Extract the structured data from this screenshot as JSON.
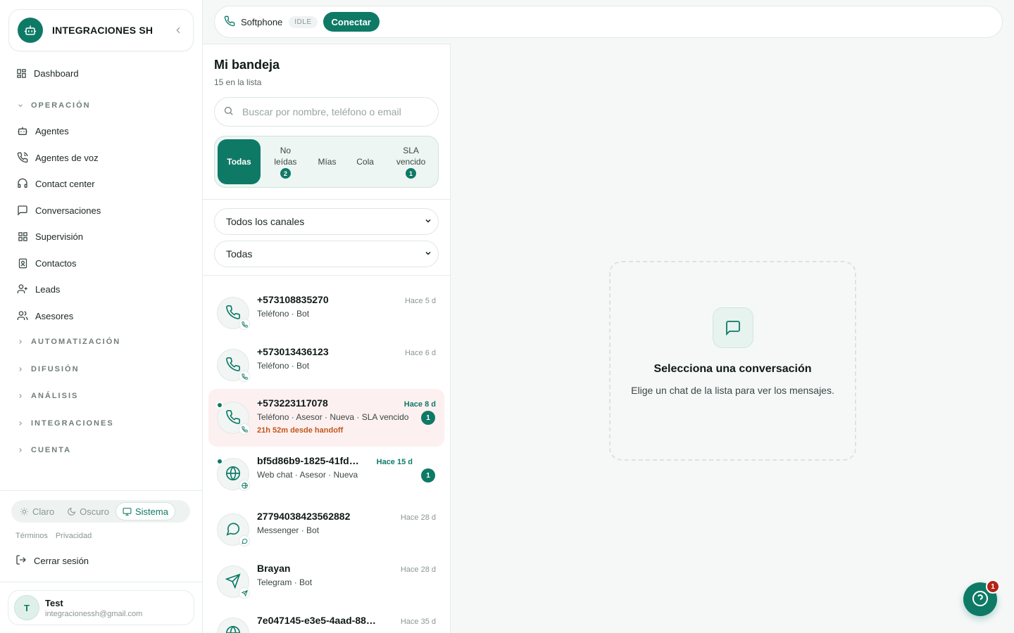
{
  "brand": {
    "name": "INTEGRACIONES SH"
  },
  "nav": {
    "dashboard": "Dashboard",
    "sections": {
      "operacion": "OPERACIÓN",
      "automatizacion": "AUTOMATIZACIÓN",
      "difusion": "DIFUSIÓN",
      "analisis": "ANÁLISIS",
      "integraciones": "INTEGRACIONES",
      "cuenta": "CUENTA"
    },
    "items": [
      {
        "label": "Agentes",
        "icon": "bot-icon"
      },
      {
        "label": "Agentes de voz",
        "icon": "phone-voice-icon"
      },
      {
        "label": "Contact center",
        "icon": "headset-icon"
      },
      {
        "label": "Conversaciones",
        "icon": "message-square-icon"
      },
      {
        "label": "Supervisión",
        "icon": "grid-icon"
      },
      {
        "label": "Contactos",
        "icon": "contact-book-icon"
      },
      {
        "label": "Leads",
        "icon": "user-plus-icon"
      },
      {
        "label": "Asesores",
        "icon": "users-icon"
      }
    ]
  },
  "theme": {
    "light": "Claro",
    "dark": "Oscuro",
    "system": "Sistema",
    "selected": "Sistema"
  },
  "legal": {
    "terms": "Términos",
    "privacy": "Privacidad"
  },
  "logout": "Cerrar sesión",
  "user": {
    "initial": "T",
    "name": "Test",
    "email": "integracionessh@gmail.com"
  },
  "topbar": {
    "softphone": "Softphone",
    "status": "IDLE",
    "connect": "Conectar"
  },
  "inbox": {
    "title": "Mi bandeja",
    "count": "15 en la lista",
    "search_placeholder": "Buscar por nombre, teléfono o email",
    "filters": [
      {
        "label": "Todas",
        "active": true
      },
      {
        "label": "No leídas",
        "count": "2"
      },
      {
        "label": "Mías"
      },
      {
        "label": "Cola"
      },
      {
        "label": "SLA vencido",
        "count": "1"
      }
    ],
    "channel_select": "Todos los canales",
    "status_select": "Todas",
    "conversations": [
      {
        "name": "+573108835270",
        "time": "Hace 5 d",
        "meta": "Teléfono · Bot",
        "icon": "phone-icon"
      },
      {
        "name": "+573013436123",
        "time": "Hace 6 d",
        "meta": "Teléfono · Bot",
        "icon": "phone-icon"
      },
      {
        "name": "+573223117078",
        "time": "Hace 8 d",
        "meta": "Teléfono · Asesor · Nueva · SLA vencido",
        "extra": "21h 52m desde handoff",
        "badge": "1",
        "icon": "phone-icon"
      },
      {
        "name": "bf5d86b9-1825-41fd…",
        "time": "Hace 15 d",
        "meta": "Web chat · Asesor · Nueva",
        "badge": "1",
        "icon": "globe-icon"
      },
      {
        "name": "27794038423562882",
        "time": "Hace 28 d",
        "meta": "Messenger · Bot",
        "icon": "messenger-icon"
      },
      {
        "name": "Brayan",
        "time": "Hace 28 d",
        "meta": "Telegram · Bot",
        "icon": "telegram-icon"
      },
      {
        "name": "7e047145-e3e5-4aad-88…",
        "time": "Hace 35 d",
        "meta": "",
        "icon": "globe-icon"
      }
    ]
  },
  "empty": {
    "title": "Selecciona una conversación",
    "subtitle": "Elige un chat de la lista para ver los mensajes."
  },
  "help": {
    "badge": "1"
  },
  "colors": {
    "accent": "#0e7a66",
    "danger": "#b42318",
    "sla": "#c0571a",
    "highlight_row": "#fdf0f0"
  }
}
